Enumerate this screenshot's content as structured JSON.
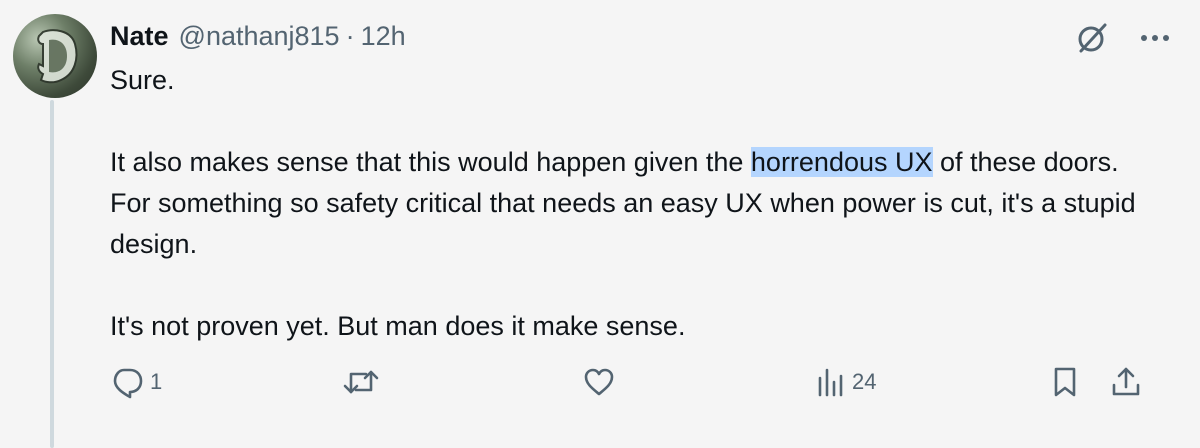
{
  "tweet": {
    "author_name": "Nate",
    "handle": "@nathanj815",
    "separator": "·",
    "time": "12h",
    "paragraph1": "Sure.",
    "paragraph2_before": "It also makes sense that this would happen given the ",
    "paragraph2_highlight": "horrendous UX",
    "paragraph2_after": " of these doors. For something so safety critical that needs an easy UX when power is cut, it's a stupid design.",
    "paragraph3": "It's not proven yet. But man does it make sense."
  },
  "actions": {
    "reply_count": "1",
    "repost_count": "",
    "like_count": "",
    "views_count": "24"
  },
  "colors": {
    "text_primary": "#0f1419",
    "text_secondary": "#536471",
    "highlight": "#b4d5fe",
    "background": "#f5f5f5"
  },
  "icons": [
    "grok-icon",
    "more-icon",
    "reply-icon",
    "repost-icon",
    "like-icon",
    "views-icon",
    "bookmark-icon",
    "share-icon"
  ]
}
